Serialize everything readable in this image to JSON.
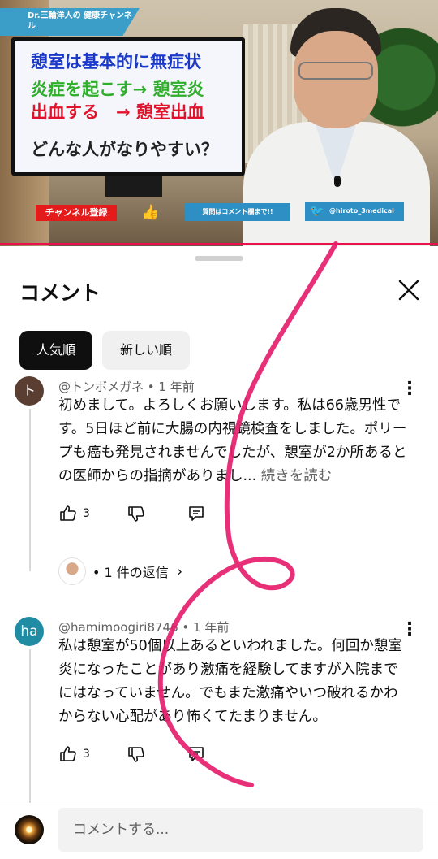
{
  "video": {
    "channel_tag": "Dr.三輪洋人の 健康チャンネル",
    "slide": {
      "line1": "憩室は基本的に無症状",
      "line2": "炎症を起こす→ 憩室炎",
      "line3": "出血する　→ 憩室出血",
      "line4": "どんな人がなりやすい？"
    },
    "subscribe_label": "チャンネル登録",
    "question_label": "質問はコメント欄まで!!",
    "twitter_handle": "@hiroto_3medical"
  },
  "sheet": {
    "title": "コメント",
    "sort_chips": [
      "人気順",
      "新しい順"
    ]
  },
  "comments": [
    {
      "avatar_letter": "ト",
      "author": "@トンボメガネ",
      "time": "1 年前",
      "text": "初めまして。よろしくお願いします。私は66歳男性です。5日ほど前に大腸の内視鏡検査をしました。ポリープも癌も発見されませんでしたが、憩室が2か所あるとの医師からの指摘がありまし...",
      "read_more": "続きを読む",
      "likes": "3",
      "replies_label": "1 件の返信"
    },
    {
      "avatar_letter": "ha",
      "author": "@hamimoogiri8746",
      "time": "1 年前",
      "text": "私は憩室が50個以上あるといわれました。何回か憩室炎になったことがあり激痛を経験してますが入院までにはなっていません。でもまた激痛やいつ破れるかわからない心配があり怖くてたまりません。",
      "likes": "3"
    }
  ],
  "composer": {
    "placeholder": "コメントする..."
  },
  "colors": {
    "accent_red": "#e8114b",
    "chip_active": "#0f0f0f",
    "scribble": "#e61e6e"
  }
}
